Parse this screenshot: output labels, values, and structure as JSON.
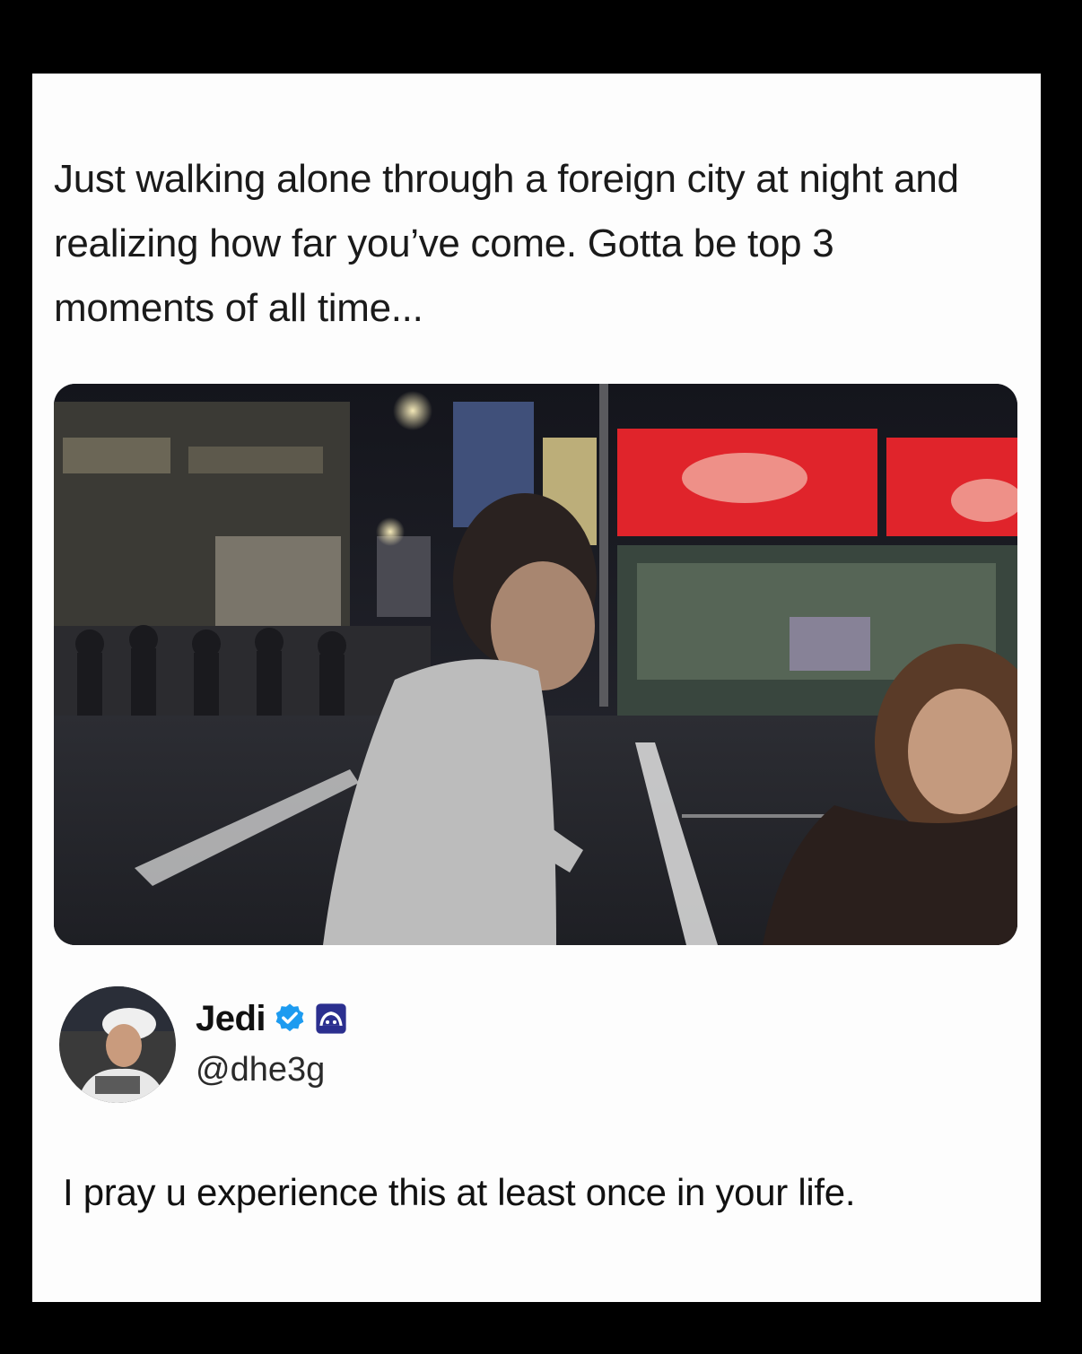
{
  "post": {
    "text": "Just walking alone through a foreign city at night and realizing how far you’ve come. Gotta be top 3 moments of all time..."
  },
  "author": {
    "name": "Jedi",
    "handle": "@dhe3g",
    "verified": true,
    "verified_icon": "verified-check-icon",
    "affiliate_icon": "affiliate-badge-icon",
    "verified_color": "#1d9bf0",
    "affiliate_color": "#2b2f8f"
  },
  "reply": {
    "text": "I pray u experience this at least once in your life."
  },
  "colors": {
    "background": "#000000",
    "card": "#fdfdfd",
    "text": "#111111",
    "storefront_sign": "#e0242b"
  }
}
